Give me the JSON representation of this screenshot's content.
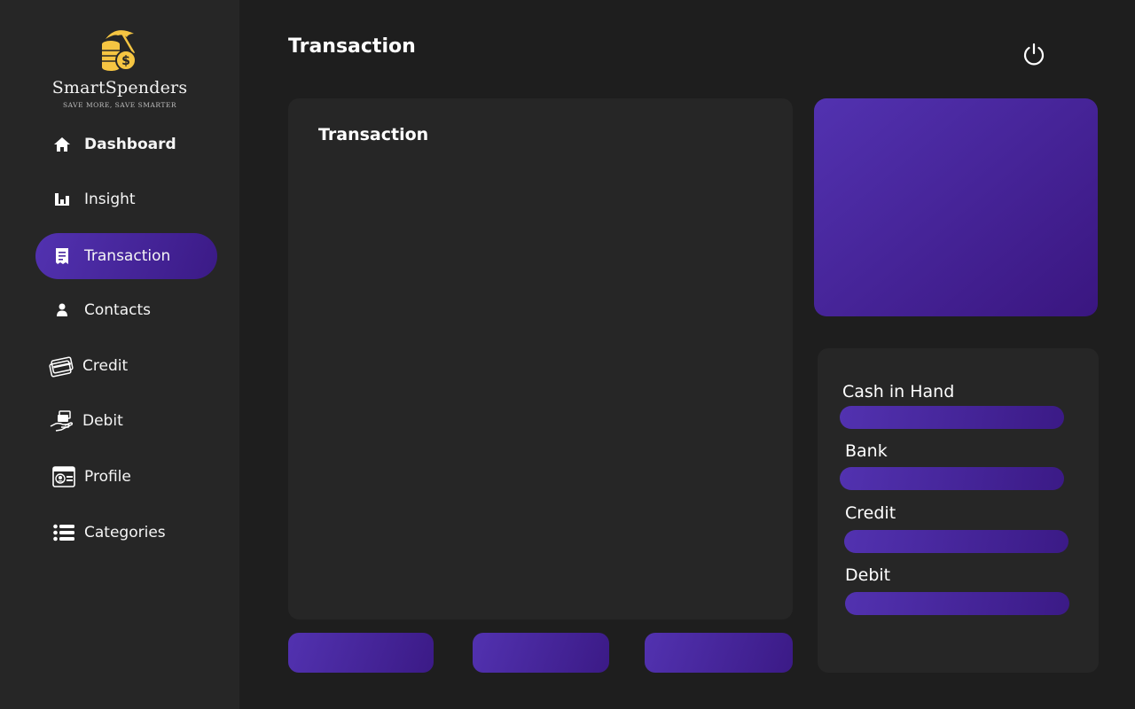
{
  "app": {
    "name": "SmartSpenders",
    "tagline": "SAVE MORE, SAVE SMARTER"
  },
  "colors": {
    "accent_start": "#5232b0",
    "accent_end": "#3b1a86",
    "background": "#1e1e1e",
    "panel": "#262626",
    "logo_gold": "#f5c542"
  },
  "sidebar": {
    "items": [
      {
        "label": "Dashboard",
        "icon": "home-icon",
        "active": false
      },
      {
        "label": "Insight",
        "icon": "bar-chart-icon",
        "active": false
      },
      {
        "label": "Transaction",
        "icon": "receipt-icon",
        "active": true
      },
      {
        "label": "Contacts",
        "icon": "person-icon",
        "active": false
      },
      {
        "label": "Credit",
        "icon": "credit-cards-icon",
        "active": false
      },
      {
        "label": "Debit",
        "icon": "hand-cash-icon",
        "active": false
      },
      {
        "label": "Profile",
        "icon": "id-card-icon",
        "active": false
      },
      {
        "label": "Categories",
        "icon": "list-icon",
        "active": false
      }
    ]
  },
  "header": {
    "title": "Transaction",
    "power_icon": "power-icon"
  },
  "main": {
    "transaction_panel_title": "Transaction"
  },
  "balances": {
    "items": [
      {
        "label": "Cash in Hand"
      },
      {
        "label": "Bank"
      },
      {
        "label": "Credit"
      },
      {
        "label": "Debit"
      }
    ]
  }
}
